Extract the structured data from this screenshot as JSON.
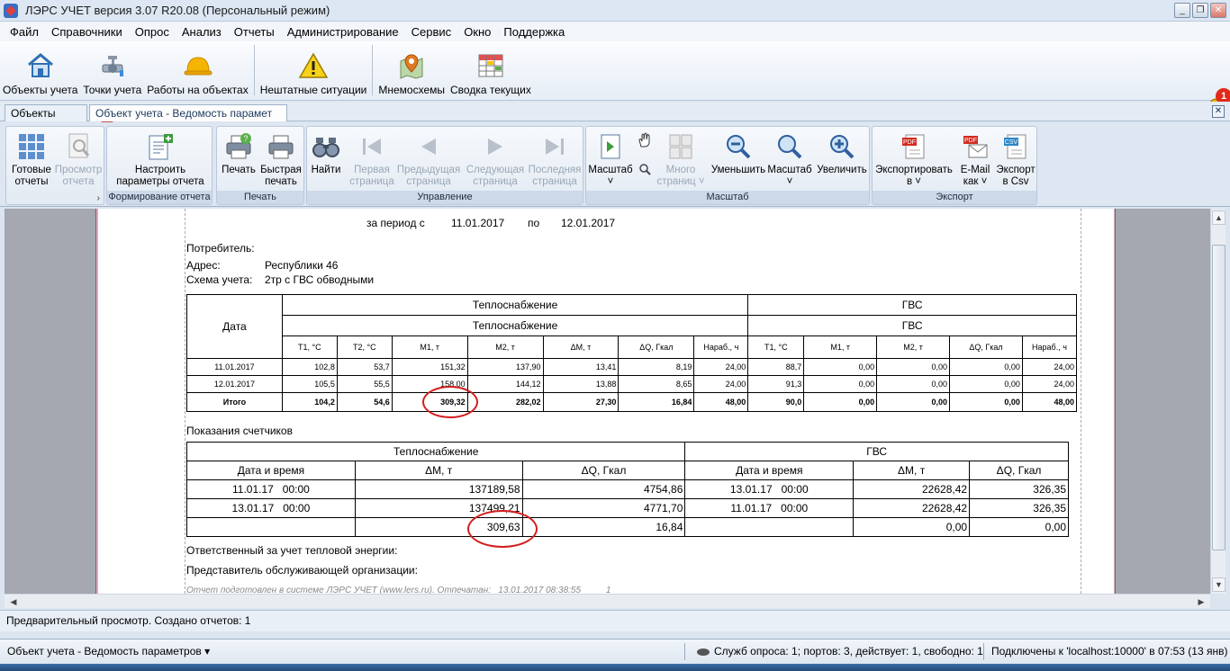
{
  "window": {
    "title": "ЛЭРС УЧЕТ версия 3.07 R20.08 (Персональный режим)",
    "minimize": "_",
    "restore": "❐",
    "close": "✕"
  },
  "menu": [
    "Файл",
    "Справочники",
    "Опрос",
    "Анализ",
    "Отчеты",
    "Администрирование",
    "Сервис",
    "Окно",
    "Поддержка"
  ],
  "main_toolbar": {
    "objects": "Объекты учета",
    "points": "Точки учета",
    "works": "Работы на объектах",
    "emergency": "Нештатные ситуации",
    "mnemo": "Мнемосхемы",
    "summary": "Сводка текущих",
    "notifications_count": "1"
  },
  "tabs": {
    "objects": "Объекты учета",
    "report": "Объект учета - Ведомость парамет",
    "close_glyph": "✕"
  },
  "ribbon": {
    "groups": {
      "report_gen": "Формирование отчета",
      "print": "Печать",
      "control": "Управление",
      "scale": "Масштаб",
      "export": "Экспорт"
    },
    "ready_reports": [
      "Готовые",
      "отчеты"
    ],
    "view_report": [
      "Просмотр",
      "отчета"
    ],
    "configure": [
      "Настроить",
      "параметры отчета"
    ],
    "print": "Печать",
    "quick_print": [
      "Быстрая",
      "печать"
    ],
    "find": "Найти",
    "first_page": [
      "Первая",
      "страница"
    ],
    "prev_page": [
      "Предыдущая",
      "страница"
    ],
    "next_page": [
      "Следующая",
      "страница"
    ],
    "last_page": [
      "Последняя",
      "страница"
    ],
    "scale": [
      "Масштаб",
      "˅"
    ],
    "multi_page": [
      "Много",
      "страниц ˅"
    ],
    "zoom_out": "Уменьшить",
    "scale2": [
      "Масштаб",
      "˅"
    ],
    "zoom_in": "Увеличить",
    "export_to": [
      "Экспортировать",
      "в ˅"
    ],
    "email_as": [
      "E-Mail",
      "как ˅"
    ],
    "export_csv": [
      "Экспорт",
      "в Csv"
    ],
    "launcher_glyph": "›"
  },
  "report": {
    "period_label": "за период с",
    "period_from": "11.01.2017",
    "period_to_label": "по",
    "period_to": "12.01.2017",
    "consumer_label": "Потребитель:",
    "address_label": "Адрес:",
    "address_value": "Республики 46",
    "scheme_label": "Схема учета:",
    "scheme_value": "2тр с ГВС обводными",
    "table1": {
      "date_header": "Дата",
      "heat": "Теплоснабжение",
      "gvs": "ГВС",
      "heat_cols": [
        "T1, °C",
        "T2, °C",
        "M1, т",
        "M2, т",
        "ΔM, т",
        "ΔQ, Гкал",
        "Нараб., ч"
      ],
      "gvs_cols": [
        "T1, °C",
        "M1, т",
        "M2, т",
        "ΔQ, Гкал",
        "Нараб., ч"
      ],
      "rows": [
        [
          "11.01.2017",
          "102,8",
          "53,7",
          "151,32",
          "137,90",
          "13,41",
          "8,19",
          "24,00",
          "88,7",
          "0,00",
          "0,00",
          "0,00",
          "24,00"
        ],
        [
          "12.01.2017",
          "105,5",
          "55,5",
          "158,00",
          "144,12",
          "13,88",
          "8,65",
          "24,00",
          "91,3",
          "0,00",
          "0,00",
          "0,00",
          "24,00"
        ]
      ],
      "total": [
        "Итого",
        "104,2",
        "54,6",
        "309,32",
        "282,02",
        "27,30",
        "16,84",
        "48,00",
        "90,0",
        "0,00",
        "0,00",
        "0,00",
        "48,00"
      ]
    },
    "meters_title": "Показания счетчиков",
    "table2": {
      "heat": "Теплоснабжение",
      "gvs": "ГВС",
      "cols": [
        "Дата и время",
        "ΔM, т",
        "ΔQ, Гкал",
        "Дата и время",
        "ΔM, т",
        "ΔQ, Гкал"
      ],
      "rows": [
        [
          "11.01.17   00:00",
          "137189,58",
          "4754,86",
          "13.01.17   00:00",
          "22628,42",
          "326,35"
        ],
        [
          "13.01.17   00:00",
          "137499,21",
          "4771,70",
          "11.01.17   00:00",
          "22628,42",
          "326,35"
        ],
        [
          "",
          "309,63",
          "16,84",
          "",
          "0,00",
          "0,00"
        ]
      ]
    },
    "responsible": "Ответственный за учет тепловой энергии:",
    "representative": "Представитель обслуживающей организации:",
    "footer": "Отчет подготовлен в системе ЛЭРС УЧЕТ (www.lers.ru). Отпечатан:   13.01.2017 08:38:55          1"
  },
  "status": {
    "preview": "Предварительный просмотр.  Создано отчетов: 1",
    "window_name": "Объект учета - Ведомость параметров ▾",
    "services": "Служб опроса: 1; портов: 3, действует: 1, свободно: 1",
    "connection": "Подключены к 'localhost:10000' в 07:53 (13 янв)"
  }
}
